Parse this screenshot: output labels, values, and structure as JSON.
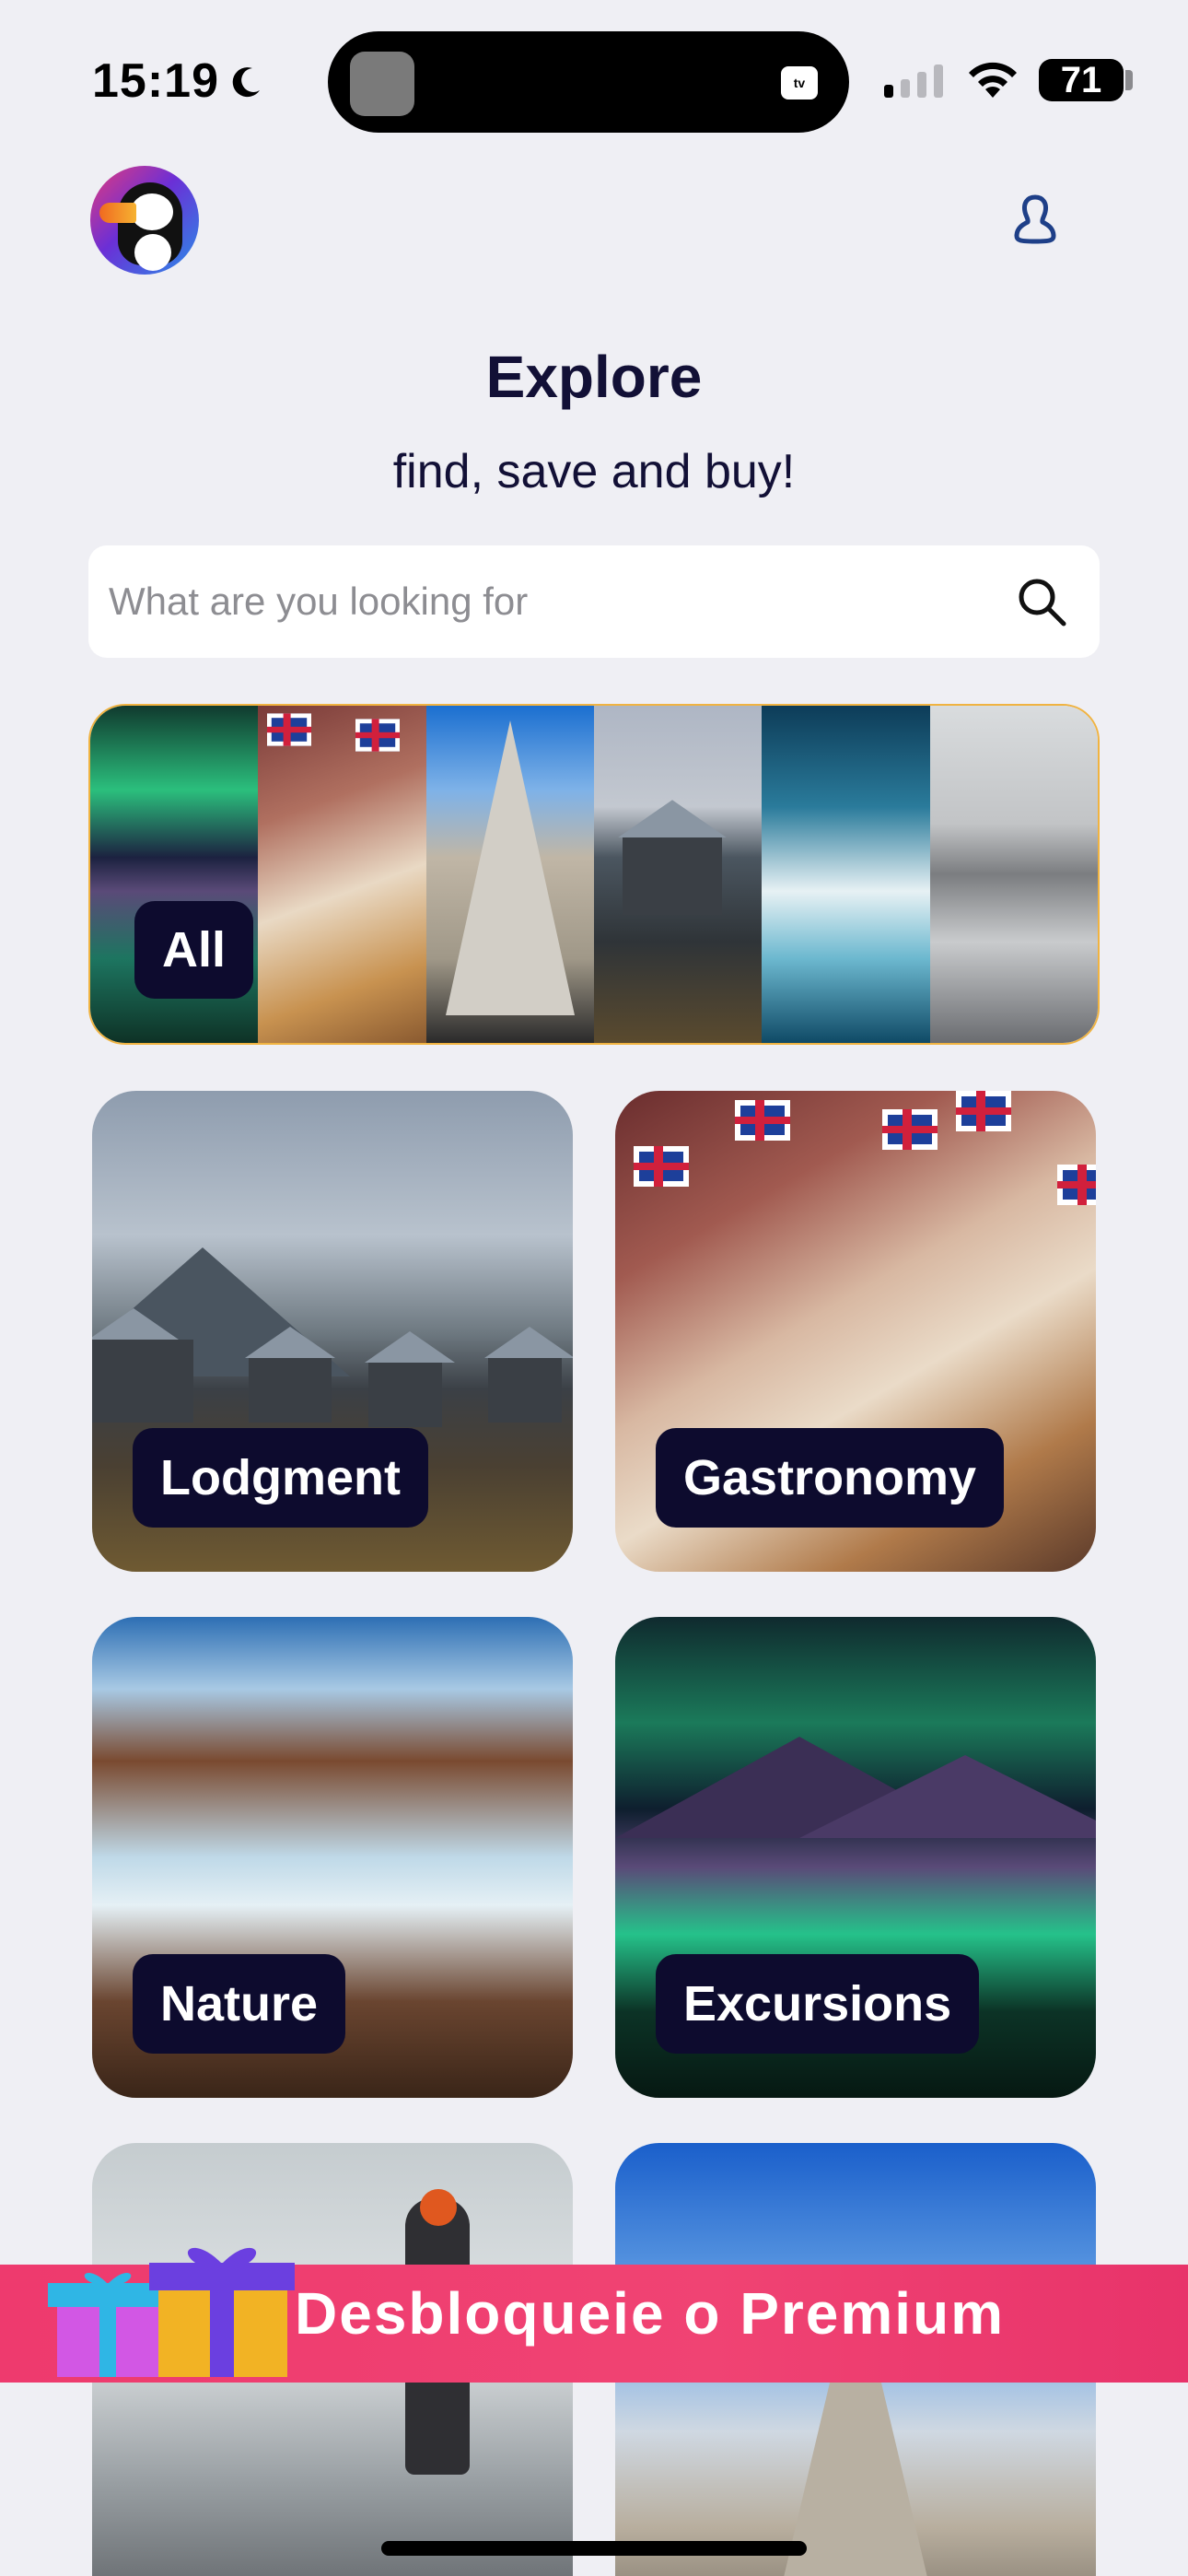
{
  "status_bar": {
    "time": "15:19",
    "battery": "71"
  },
  "header": {
    "title": "Explore",
    "subtitle": "find, save and buy!"
  },
  "search": {
    "placeholder": "What are you looking for",
    "value": ""
  },
  "categories": {
    "all": "All",
    "items": [
      {
        "label": "Lodgment"
      },
      {
        "label": "Gastronomy"
      },
      {
        "label": "Nature"
      },
      {
        "label": "Excursions"
      }
    ]
  },
  "premium": {
    "label": "Desbloqueie o Premium"
  },
  "icons": {
    "moon": "moon-icon",
    "profile": "user-profile-icon",
    "search": "search-icon",
    "gift": "gift-icon"
  },
  "colors": {
    "background": "#efeff4",
    "chip": "#0d0b2e",
    "premium": "#f04373",
    "all_border": "#f0b341"
  }
}
